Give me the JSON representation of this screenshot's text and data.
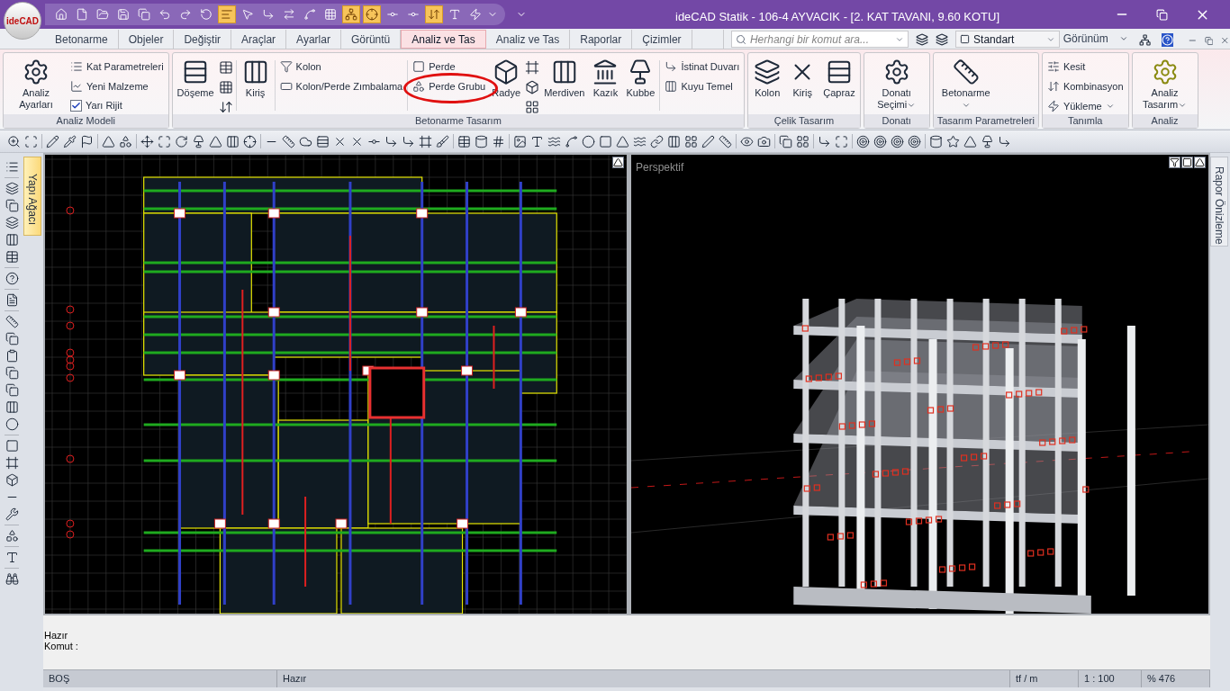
{
  "title_bar": {
    "logo": "ideCAD",
    "title": "ideCAD Statik - 106-4 AYVACIK - [2. KAT TAVANI,  9.60 KOTU]"
  },
  "quick_tools": [
    {
      "active": false
    },
    {
      "active": false
    },
    {
      "active": false
    },
    {
      "active": false
    },
    {
      "active": false
    },
    {
      "active": false
    },
    {
      "active": false
    },
    {
      "active": false
    },
    {
      "active": true
    },
    {
      "active": false
    },
    {
      "active": false
    },
    {
      "active": false
    },
    {
      "active": false
    },
    {
      "active": false
    },
    {
      "active": true
    },
    {
      "active": true
    },
    {
      "active": false
    },
    {
      "active": false
    },
    {
      "active": true
    },
    {
      "active": false
    },
    {
      "active": false
    }
  ],
  "tabs": [
    {
      "label": "Betonarme",
      "selected": false
    },
    {
      "label": "Objeler",
      "selected": false
    },
    {
      "label": "Değiştir",
      "selected": false
    },
    {
      "label": "Araçlar",
      "selected": false
    },
    {
      "label": "Ayarlar",
      "selected": false
    },
    {
      "label": "Görüntü",
      "selected": false
    },
    {
      "label": "Analiz ve Tas",
      "selected": true
    },
    {
      "label": "Analiz ve Tas",
      "selected": false
    },
    {
      "label": "Raporlar",
      "selected": false
    },
    {
      "label": "Çizimler",
      "selected": false
    }
  ],
  "search": {
    "placeholder": "Herhangi bir komut ara..."
  },
  "layer": {
    "value": "Standart"
  },
  "view_menu": {
    "label": "Görünüm"
  },
  "ribbon": {
    "groups": [
      {
        "title": "Analiz Modeli",
        "columns": [
          {
            "kind": "large",
            "label": "Analiz Ayarları",
            "menu": false
          },
          {
            "kind": "stack",
            "items": [
              {
                "kind": "button",
                "label": "Kat Parametreleri",
                "annotated": false
              },
              {
                "kind": "button",
                "label": "Yeni Malzeme",
                "annotated": false
              },
              {
                "kind": "checkbox",
                "label": "Yarı Rijit",
                "checked": true
              }
            ]
          }
        ]
      },
      {
        "title": "Betonarme Tasarım",
        "columns": [
          {
            "kind": "large",
            "label": "Döşeme",
            "menu": false
          },
          {
            "kind": "icons"
          },
          {
            "kind": "sep"
          },
          {
            "kind": "large",
            "label": "Kiriş",
            "menu": false
          },
          {
            "kind": "sep"
          },
          {
            "kind": "stack",
            "items": [
              {
                "kind": "button",
                "label": "Kolon",
                "annotated": false
              },
              {
                "kind": "button",
                "label": "Kolon/Perde Zımbalama",
                "annotated": false
              }
            ]
          },
          {
            "kind": "sep"
          },
          {
            "kind": "stack",
            "items": [
              {
                "kind": "button",
                "label": "Perde",
                "annotated": false
              },
              {
                "kind": "button",
                "label": "Perde Grubu",
                "annotated": true
              }
            ]
          },
          {
            "kind": "large",
            "label": "Radye",
            "menu": false
          },
          {
            "kind": "icons"
          },
          {
            "kind": "large",
            "label": "Merdiven",
            "menu": false
          },
          {
            "kind": "large",
            "label": "Kazık",
            "menu": false
          },
          {
            "kind": "large",
            "label": "Kubbe",
            "menu": false
          },
          {
            "kind": "sep"
          },
          {
            "kind": "stack",
            "items": [
              {
                "kind": "button",
                "label": "İstinat Duvarı",
                "annotated": false
              },
              {
                "kind": "button",
                "label": "Kuyu Temel",
                "annotated": false
              }
            ]
          }
        ]
      },
      {
        "title": "Çelik Tasarım",
        "columns": [
          {
            "kind": "large",
            "label": "Kolon",
            "menu": false
          },
          {
            "kind": "large",
            "label": "Kiriş",
            "menu": false
          },
          {
            "kind": "large",
            "label": "Çapraz",
            "menu": false
          }
        ]
      },
      {
        "title": "Donatı",
        "columns": [
          {
            "kind": "large",
            "label": "Donatı Seçimi",
            "menu": true
          }
        ]
      },
      {
        "title": "Tasarım Parametreleri",
        "columns": [
          {
            "kind": "large",
            "label": "Betonarme",
            "menu": true
          }
        ]
      },
      {
        "title": "Tanımla",
        "columns": [
          {
            "kind": "stack",
            "items": [
              {
                "kind": "button",
                "label": "Kesit",
                "annotated": false
              },
              {
                "kind": "button",
                "label": "Kombinasyon",
                "annotated": false
              },
              {
                "kind": "menu",
                "label": "Yükleme",
                "annotated": false
              }
            ]
          }
        ]
      },
      {
        "title": "Analiz",
        "columns": [
          {
            "kind": "large",
            "label": "Analiz Tasarım",
            "menu": true
          }
        ]
      }
    ]
  },
  "left_panel_tab": "Yapı Ağacı",
  "right_panel_tab": "Rapor Önizleme",
  "perspective_view": {
    "label": "Perspektif"
  },
  "command_lines": [
    "Hazır",
    "Komut :"
  ],
  "status_bar": [
    "BOŞ",
    "Hazır",
    "tf / m",
    "1 : 100",
    "% 476"
  ]
}
